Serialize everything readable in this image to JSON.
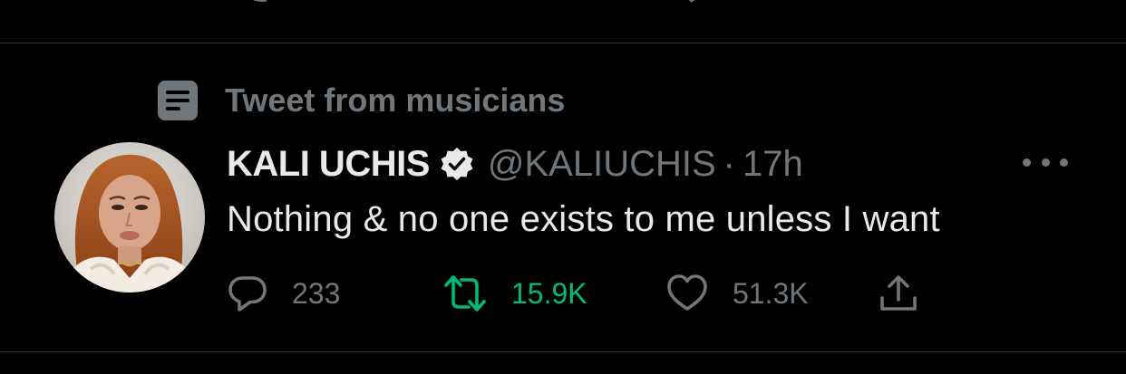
{
  "context": {
    "label": "Tweet from musicians",
    "icon": "list-icon"
  },
  "tweet": {
    "author_name": "KALI UCHIS",
    "verified": true,
    "handle": "@KALIUCHIS",
    "separator": "·",
    "time": "17h",
    "text": "Nothing & no one exists to me unless I want",
    "avatar": "profile-photo"
  },
  "actions": {
    "replies": "233",
    "retweets": "15.9K",
    "likes": "51.3K"
  },
  "colors": {
    "background": "#000000",
    "primary_text": "#e7e9ea",
    "secondary_text": "#71767b",
    "retweet_active": "#00ba7c",
    "divider": "#2f3336"
  }
}
